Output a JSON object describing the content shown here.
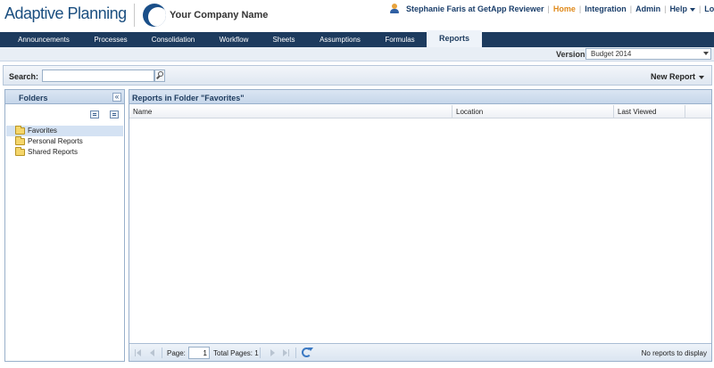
{
  "header": {
    "app_logo": "Adaptive Planning",
    "company_name": "Your Company Name",
    "user": "Stephanie Faris at GetApp Reviewer",
    "links": {
      "home": "Home",
      "integration": "Integration",
      "admin": "Admin",
      "help": "Help",
      "logout": "Logout"
    }
  },
  "tabs": [
    {
      "label": "Announcements"
    },
    {
      "label": "Processes"
    },
    {
      "label": "Consolidation"
    },
    {
      "label": "Workflow"
    },
    {
      "label": "Sheets"
    },
    {
      "label": "Assumptions"
    },
    {
      "label": "Formulas"
    },
    {
      "label": "Reports",
      "active": true
    }
  ],
  "version": {
    "label": "Version:",
    "selected": "Budget 2014"
  },
  "toolbar": {
    "search_label": "Search:",
    "search_value": "",
    "new_report": "New Report"
  },
  "folders": {
    "title": "Folders",
    "items": [
      {
        "label": "Favorites",
        "selected": true
      },
      {
        "label": "Personal Reports"
      },
      {
        "label": "Shared Reports"
      }
    ]
  },
  "grid": {
    "title": "Reports in Folder \"Favorites\"",
    "columns": [
      "Name",
      "Location",
      "Last Viewed"
    ],
    "rows": []
  },
  "pager": {
    "page_label": "Page:",
    "page_value": "1",
    "total_pages": "Total Pages: 1",
    "status": "No reports to display"
  },
  "colors": {
    "tab_bar": "#1d3b5e",
    "active_link": "#e08a1b",
    "brand_blue": "#1b4f80"
  }
}
